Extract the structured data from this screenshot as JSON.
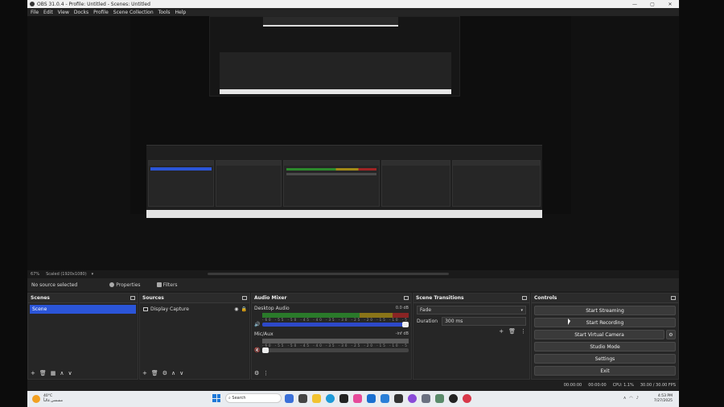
{
  "window": {
    "title": "OBS 31.0.4 - Profile: Untitled - Scenes: Untitled",
    "controls": [
      "—",
      "▢",
      "✕"
    ]
  },
  "menu": [
    "File",
    "Edit",
    "View",
    "Docks",
    "Profile",
    "Scene Collection",
    "Tools",
    "Help"
  ],
  "statusline": {
    "zoom": "67%",
    "scale": "Scaled (1920x1080)"
  },
  "source_toolbar": {
    "no_source": "No source selected",
    "properties": "Properties",
    "filters": "Filters"
  },
  "scenes": {
    "title": "Scenes",
    "items": [
      "Scene"
    ]
  },
  "sources": {
    "title": "Sources",
    "items": [
      "Display Capture"
    ]
  },
  "mixer": {
    "title": "Audio Mixer",
    "channels": [
      {
        "name": "Desktop Audio",
        "db": "0.0 dB"
      },
      {
        "name": "Mic/Aux",
        "db": "-inf dB"
      }
    ],
    "ticks": "-60 -55 -50 -45 -40 -35 -30 -25 -20 -15 -10 -5 0"
  },
  "transitions": {
    "title": "Scene Transitions",
    "type": "Fade",
    "duration_label": "Duration",
    "duration": "300 ms"
  },
  "controls": {
    "title": "Controls",
    "start_streaming": "Start Streaming",
    "start_recording": "Start Recording",
    "start_virtual_camera": "Start Virtual Camera",
    "studio_mode": "Studio Mode",
    "settings": "Settings",
    "exit": "Exit"
  },
  "status": {
    "stream_time": "00:00:00",
    "rec_time": "00:00:00",
    "cpu": "CPU: 1.1%",
    "fps": "30.00 / 30.00 FPS"
  },
  "taskbar": {
    "temp": "40°C",
    "weather": "مشمس غالباً",
    "search": "Search",
    "time": "4:53 PM",
    "date": "7/27/2025"
  }
}
